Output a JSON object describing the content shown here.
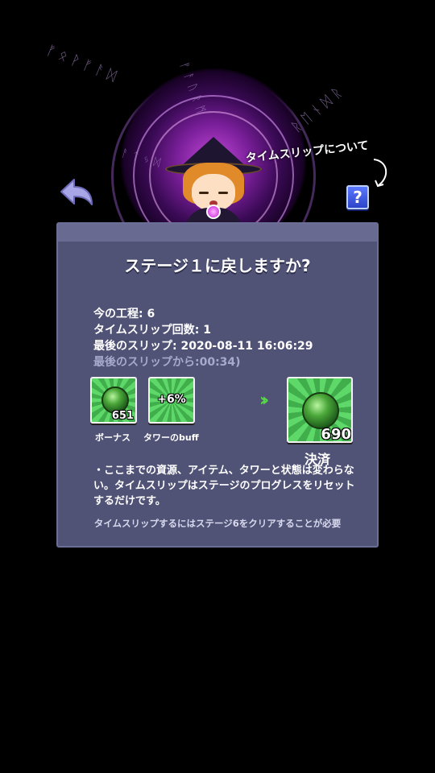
{
  "header": {
    "back_icon": "back-arrow-icon",
    "about_label": "タイムスリップについて",
    "help_label": "?",
    "runes": [
      "ᚠᛟᚹᚠᚨᛞ",
      "ᚠᚨᚢᚱᛗ",
      "ᚱᛖᚾᛞᚱ",
      "ᚨᛏᛃᛞ"
    ]
  },
  "dialog": {
    "title": "ステージ１に戻しますか?",
    "info": {
      "progress": "今の工程: 6",
      "slip_count": "タイムスリップ回数: 1",
      "last_slip": "最後のスリップ: 2020-08-11 16:06:29",
      "since_last": "最後のスリップから:00:34)"
    },
    "rewards": {
      "bonus_value": "651",
      "bonus_label": "ボーナス",
      "buff_value": "+6%",
      "buff_label": "タワーのbuff",
      "arrow": "››",
      "pay_value": "690",
      "pay_label": "決済"
    },
    "notes": "・ここまでの資源、アイテム、タワーと状態は変わらない。タイムスリップはステージのプログレスをリセットするだけです。",
    "requirement": "タイムスリップするにはステージ6をクリアすることが必要"
  },
  "colors": {
    "dialog_bg": "#505276",
    "accent_green": "#55d845",
    "portal_purple": "#c54ad9",
    "help_blue": "#3a58e0"
  }
}
